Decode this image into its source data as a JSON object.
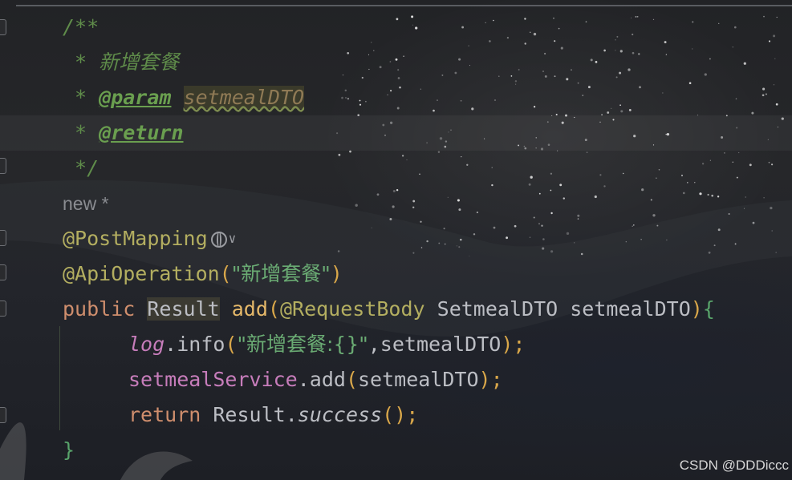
{
  "editor": {
    "lines": [
      {
        "id": "doc-open",
        "text": "/**"
      },
      {
        "id": "doc-desc",
        "star": " * ",
        "text": "新增套餐"
      },
      {
        "id": "doc-param",
        "star": " * ",
        "tag": "@param",
        "param": "setmealDTO"
      },
      {
        "id": "doc-return",
        "star": " * ",
        "tag": "@return"
      },
      {
        "id": "doc-close",
        "text": " */"
      },
      {
        "id": "usage-hint",
        "text": "new *"
      },
      {
        "id": "post-mapping",
        "text": "@PostMapping"
      },
      {
        "id": "api-operation",
        "annotation": "@ApiOperation",
        "open": "(",
        "string": "\"新增套餐\"",
        "close": ")"
      },
      {
        "id": "method-sig",
        "kw": "public",
        "type": "Result",
        "name": "add",
        "open": "(",
        "param_ann": "@RequestBody",
        "param_type": "SetmealDTO",
        "param_name": "setmealDTO",
        "close": ")",
        "brace": "{"
      },
      {
        "id": "log-line",
        "obj": "log",
        "dot": ".",
        "method": "info",
        "open": "(",
        "string": "\"新增套餐:{}\"",
        "rest": ",setmealDTO",
        "close": ");"
      },
      {
        "id": "service-line",
        "obj": "setmealService",
        "dot": ".",
        "method": "add",
        "open": "(",
        "arg": "setmealDTO",
        "close": ");"
      },
      {
        "id": "return-line",
        "kw": "return",
        "obj": "Result",
        "dot": ".",
        "method": "success",
        "open": "()",
        "close": ";"
      },
      {
        "id": "close-brace",
        "text": "}"
      }
    ]
  },
  "watermark": "CSDN @DDDiccc",
  "colors": {
    "background": "#1f2022",
    "comment": "#5f8c4a",
    "annotation": "#b3ae60",
    "string": "#6aab73",
    "keyword": "#cf8e6d",
    "method": "#56a8f5",
    "field": "#c77dbb"
  },
  "icons": [
    "globe-icon",
    "chevron-down-icon",
    "fold-marker-icon"
  ]
}
